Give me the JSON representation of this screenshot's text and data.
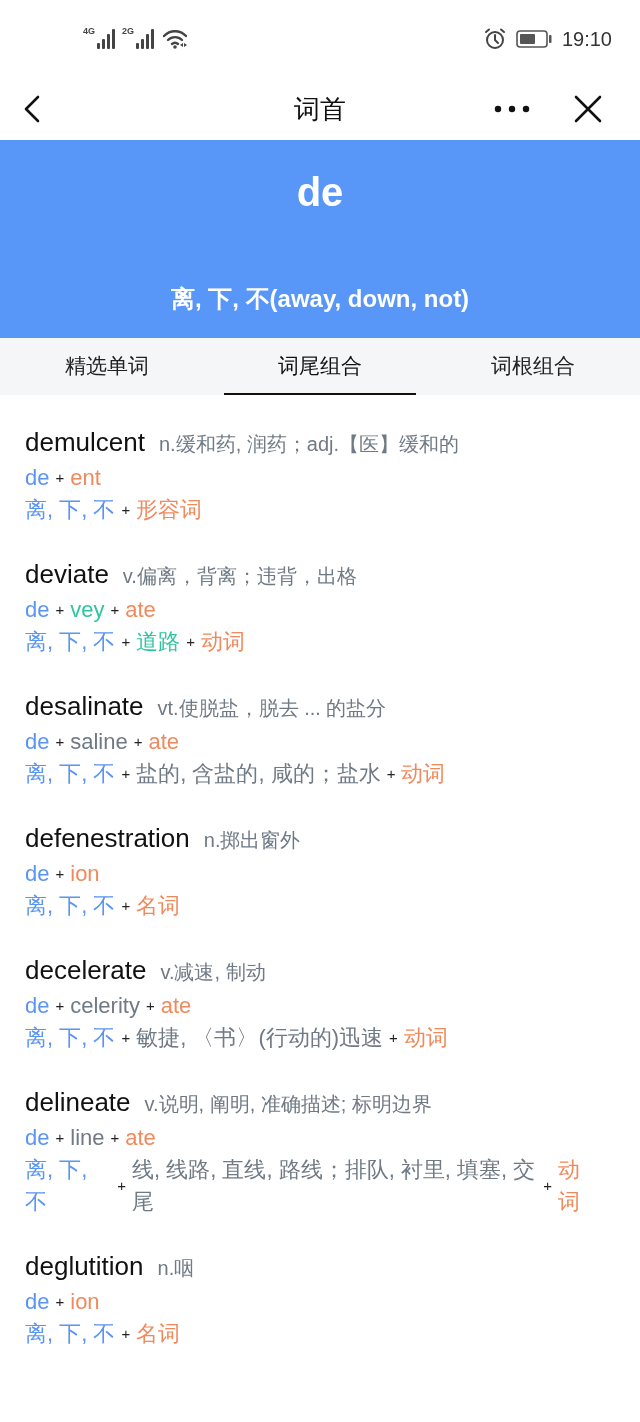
{
  "status_bar": {
    "signals": [
      {
        "label": "4G"
      },
      {
        "label": "2G"
      }
    ],
    "time": "19:10"
  },
  "nav": {
    "title": "词首"
  },
  "banner": {
    "root": "de",
    "meaning": "离, 下, 不(away, down, not)"
  },
  "tabs": [
    {
      "label": "精选单词",
      "selected": false
    },
    {
      "label": "词尾组合",
      "selected": true
    },
    {
      "label": "词根组合",
      "selected": false
    }
  ],
  "entries": [
    {
      "word": "demulcent",
      "definition": "n.缓和药, 润药；adj.【医】缓和的",
      "parts": [
        {
          "kind": "prefix",
          "text": "de"
        },
        {
          "kind": "plus",
          "text": "+"
        },
        {
          "kind": "suffix",
          "text": "ent"
        }
      ],
      "meanings": [
        {
          "kind": "prefix",
          "text": "离, 下, 不"
        },
        {
          "kind": "plus",
          "text": "+"
        },
        {
          "kind": "suffix",
          "text": "形容词"
        }
      ]
    },
    {
      "word": "deviate",
      "definition": "v.偏离，背离；违背，出格",
      "parts": [
        {
          "kind": "prefix",
          "text": "de"
        },
        {
          "kind": "plus",
          "text": "+"
        },
        {
          "kind": "root",
          "text": "vey"
        },
        {
          "kind": "plus",
          "text": "+"
        },
        {
          "kind": "suffix",
          "text": "ate"
        }
      ],
      "meanings": [
        {
          "kind": "prefix",
          "text": "离, 下, 不"
        },
        {
          "kind": "plus",
          "text": "+"
        },
        {
          "kind": "root",
          "text": "道路"
        },
        {
          "kind": "plus",
          "text": "+"
        },
        {
          "kind": "suffix",
          "text": "动词"
        }
      ]
    },
    {
      "word": "desalinate",
      "definition": "vt.使脱盐，脱去 ... 的盐分",
      "parts": [
        {
          "kind": "prefix",
          "text": "de"
        },
        {
          "kind": "plus",
          "text": "+"
        },
        {
          "kind": "word",
          "text": "saline"
        },
        {
          "kind": "plus",
          "text": "+"
        },
        {
          "kind": "suffix",
          "text": "ate"
        }
      ],
      "meanings": [
        {
          "kind": "prefix",
          "text": "离, 下, 不"
        },
        {
          "kind": "plus",
          "text": "+"
        },
        {
          "kind": "word",
          "text": "盐的, 含盐的, 咸的；盐水"
        },
        {
          "kind": "plus",
          "text": "+"
        },
        {
          "kind": "suffix",
          "text": "动词"
        }
      ]
    },
    {
      "word": "defenestration",
      "definition": "n.掷出窗外",
      "parts": [
        {
          "kind": "prefix",
          "text": "de"
        },
        {
          "kind": "plus",
          "text": "+"
        },
        {
          "kind": "suffix",
          "text": "ion"
        }
      ],
      "meanings": [
        {
          "kind": "prefix",
          "text": "离, 下, 不"
        },
        {
          "kind": "plus",
          "text": "+"
        },
        {
          "kind": "suffix",
          "text": "名词"
        }
      ]
    },
    {
      "word": "decelerate",
      "definition": "v.减速, 制动",
      "parts": [
        {
          "kind": "prefix",
          "text": "de"
        },
        {
          "kind": "plus",
          "text": "+"
        },
        {
          "kind": "word",
          "text": "celerity"
        },
        {
          "kind": "plus",
          "text": "+"
        },
        {
          "kind": "suffix",
          "text": "ate"
        }
      ],
      "meanings": [
        {
          "kind": "prefix",
          "text": "离, 下, 不"
        },
        {
          "kind": "plus",
          "text": "+"
        },
        {
          "kind": "word",
          "text": "敏捷, 〈书〉(行动的)迅速"
        },
        {
          "kind": "plus",
          "text": "+"
        },
        {
          "kind": "suffix",
          "text": "动词"
        }
      ]
    },
    {
      "word": "delineate",
      "definition": "v.说明, 阐明, 准确描述; 标明边界",
      "parts": [
        {
          "kind": "prefix",
          "text": "de"
        },
        {
          "kind": "plus",
          "text": "+"
        },
        {
          "kind": "word",
          "text": "line"
        },
        {
          "kind": "plus",
          "text": "+"
        },
        {
          "kind": "suffix",
          "text": "ate"
        }
      ],
      "meanings": [
        {
          "kind": "prefix",
          "text": "离, 下, 不"
        },
        {
          "kind": "plus",
          "text": "+"
        },
        {
          "kind": "word",
          "text": "线, 线路, 直线, 路线；排队, 衬里, 填塞, 交尾"
        },
        {
          "kind": "plus",
          "text": "+"
        },
        {
          "kind": "suffix",
          "text": "动词"
        }
      ]
    },
    {
      "word": "deglutition",
      "definition": "n.咽",
      "parts": [
        {
          "kind": "prefix",
          "text": "de"
        },
        {
          "kind": "plus",
          "text": "+"
        },
        {
          "kind": "suffix",
          "text": "ion"
        }
      ],
      "meanings": [
        {
          "kind": "prefix",
          "text": "离, 下, 不"
        },
        {
          "kind": "plus",
          "text": "+"
        },
        {
          "kind": "suffix",
          "text": "名词"
        }
      ]
    }
  ]
}
